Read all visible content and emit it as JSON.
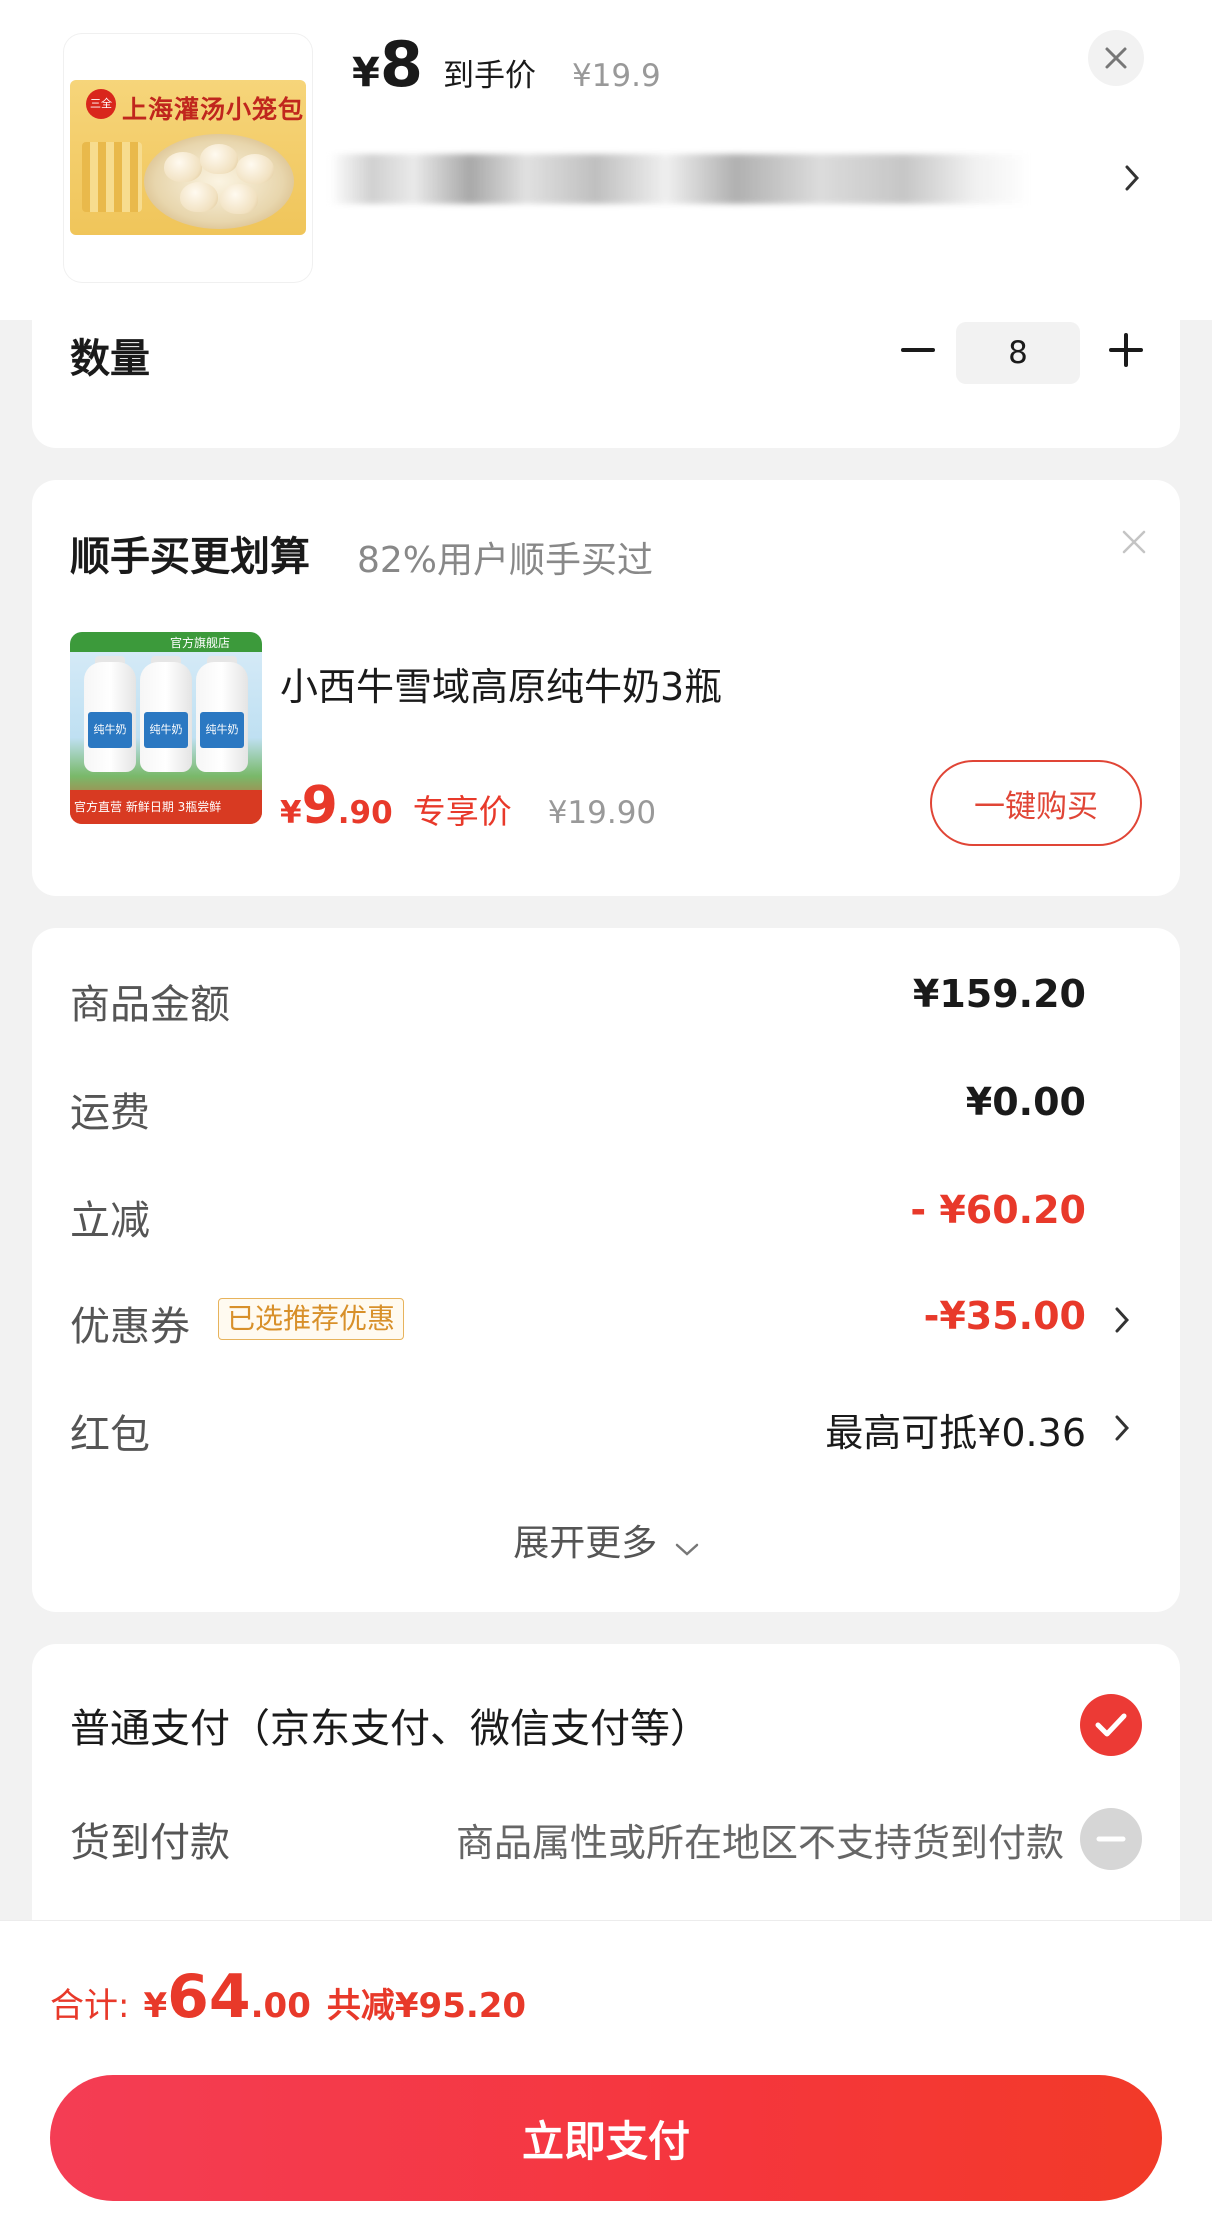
{
  "product": {
    "price_yen": "¥",
    "price_value": "8",
    "price_tag": "到手价",
    "original_price": "¥19.9",
    "image_label": "上海灌汤小笼包",
    "brand_badge": "三全"
  },
  "quantity": {
    "label": "数量",
    "value": "8"
  },
  "upsell": {
    "title": "顺手买更划算",
    "subtitle": "82%用户顺手买过",
    "item_name": "小西牛雪域高原纯牛奶3瓶",
    "price_yen": "¥",
    "price_int": "9",
    "price_dec": ".90",
    "price_tag": "专享价",
    "original_price": "¥19.90",
    "buy_button": "一键购买",
    "image_shop": "官方旗舰店",
    "image_bottle_label": "纯牛奶",
    "image_tags": "官方直营 新鲜日期 3瓶尝鲜"
  },
  "summary": {
    "rows": [
      {
        "label": "商品金额",
        "value": "¥159.20"
      },
      {
        "label": "运费",
        "value": "¥0.00"
      },
      {
        "label": "立减",
        "value": "- ¥60.20"
      },
      {
        "label": "优惠券",
        "badge": "已选推荐优惠",
        "value": "-¥35.00"
      },
      {
        "label": "红包",
        "value": "最高可抵¥0.36"
      }
    ],
    "expand_more": "展开更多"
  },
  "payment": {
    "normal_label": "普通支付（京东支付、微信支付等）",
    "cod_label": "货到付款",
    "cod_note": "商品属性或所在地区不支持货到付款"
  },
  "bottom": {
    "total_label": "合计:",
    "total_yen": "¥",
    "total_int": "64",
    "total_dec": ".00",
    "total_saved": "共减¥95.20",
    "pay_button": "立即支付"
  },
  "colors": {
    "accent_red": "#e8392a",
    "pay_button_red": "#f5363d",
    "coupon_badge_gold": "#d8902a"
  }
}
